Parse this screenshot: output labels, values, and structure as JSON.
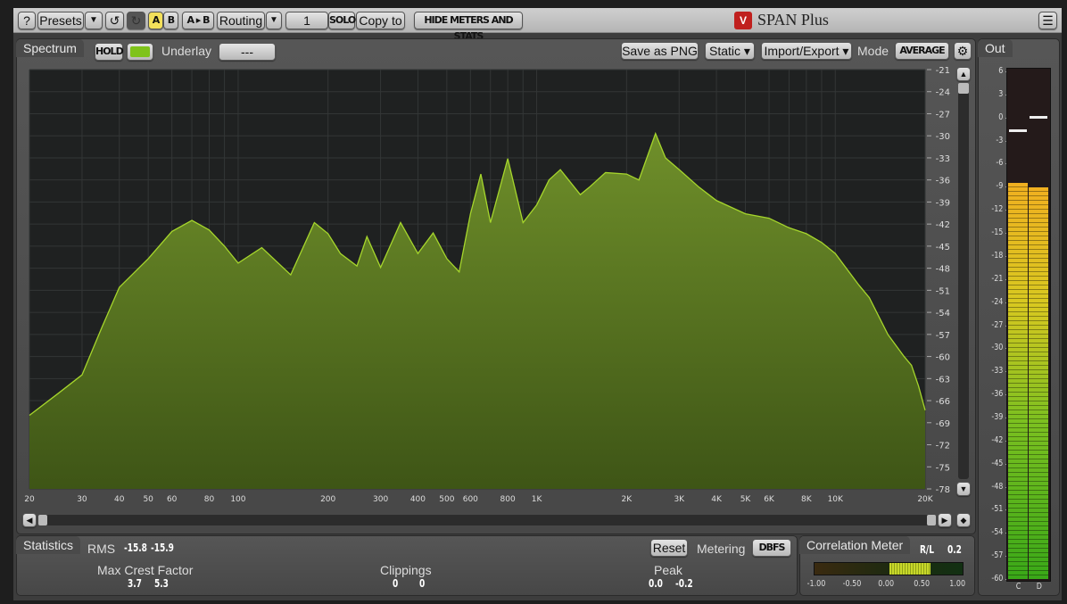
{
  "toolbar": {
    "help": "?",
    "presets": "Presets",
    "ab_a": "A",
    "ab_b": "B",
    "a_to_b": "A ▸ B",
    "routing": "Routing",
    "channel": "1",
    "solo": "SOLO",
    "copy_to": "Copy to",
    "hide_meters": "HIDE METERS AND STATS"
  },
  "app": {
    "title": "SPAN Plus"
  },
  "spectrum": {
    "tab": "Spectrum",
    "hold": "HOLD",
    "underlay_label": "Underlay",
    "underlay_value": "---",
    "save_png": "Save as PNG",
    "static": "Static ▾",
    "import_export": "Import/Export ▾",
    "mode_label": "Mode",
    "mode_value": "AVERAGE",
    "hold_color": "#7fc31a"
  },
  "chart_data": {
    "type": "area",
    "xscale": "log",
    "xlim": [
      20,
      20000
    ],
    "ylim": [
      -78,
      -21
    ],
    "x_ticks": [
      {
        "v": 20,
        "l": "20"
      },
      {
        "v": 30,
        "l": "30"
      },
      {
        "v": 40,
        "l": "40"
      },
      {
        "v": 50,
        "l": "50"
      },
      {
        "v": 60,
        "l": "60"
      },
      {
        "v": 80,
        "l": "80"
      },
      {
        "v": 100,
        "l": "100"
      },
      {
        "v": 200,
        "l": "200"
      },
      {
        "v": 300,
        "l": "300"
      },
      {
        "v": 400,
        "l": "400"
      },
      {
        "v": 500,
        "l": "500"
      },
      {
        "v": 600,
        "l": "600"
      },
      {
        "v": 800,
        "l": "800"
      },
      {
        "v": 1000,
        "l": "1K"
      },
      {
        "v": 2000,
        "l": "2K"
      },
      {
        "v": 3000,
        "l": "3K"
      },
      {
        "v": 4000,
        "l": "4K"
      },
      {
        "v": 5000,
        "l": "5K"
      },
      {
        "v": 6000,
        "l": "6K"
      },
      {
        "v": 8000,
        "l": "8K"
      },
      {
        "v": 10000,
        "l": "10K"
      },
      {
        "v": 20000,
        "l": "20K"
      }
    ],
    "y_ticks": [
      -21,
      -24,
      -27,
      -30,
      -33,
      -36,
      -39,
      -42,
      -45,
      -48,
      -51,
      -54,
      -57,
      -60,
      -63,
      -66,
      -69,
      -72,
      -75,
      -78
    ],
    "x": [
      20,
      25,
      30,
      35,
      40,
      50,
      60,
      70,
      80,
      90,
      100,
      120,
      150,
      180,
      200,
      220,
      250,
      270,
      300,
      350,
      400,
      450,
      500,
      550,
      600,
      650,
      700,
      800,
      900,
      1000,
      1100,
      1200,
      1400,
      1500,
      1700,
      2000,
      2200,
      2500,
      2700,
      3000,
      3500,
      4000,
      5000,
      6000,
      7000,
      8000,
      9000,
      10000,
      12000,
      13000,
      15000,
      17000,
      18000,
      19000,
      20000
    ],
    "y": [
      -68,
      -65,
      -62.5,
      -56,
      -50.6,
      -46.7,
      -43,
      -41.5,
      -42.8,
      -45,
      -47.3,
      -45.2,
      -48.9,
      -41.8,
      -43.3,
      -46,
      -47.7,
      -43.7,
      -47.9,
      -41.8,
      -46,
      -43.2,
      -46.7,
      -48.5,
      -40.6,
      -35.2,
      -41.8,
      -33.1,
      -41.8,
      -39.4,
      -36,
      -34.6,
      -38,
      -37,
      -35,
      -35.2,
      -36,
      -29.7,
      -33,
      -34.6,
      -37,
      -38.8,
      -40.6,
      -41.2,
      -42.5,
      -43.3,
      -44.5,
      -46,
      -50.3,
      -52,
      -57,
      -60,
      -61.2,
      -64,
      -67.3
    ]
  },
  "statistics": {
    "tab": "Statistics",
    "rms_label": "RMS",
    "rms_l": "-15.8",
    "rms_r": "-15.9",
    "reset": "Reset",
    "metering_label": "Metering",
    "metering_value": "DBFS",
    "crest_label": "Max Crest Factor",
    "crest_l": "3.7",
    "crest_r": "5.3",
    "clip_label": "Clippings",
    "clip_l": "0",
    "clip_r": "0",
    "peak_label": "Peak",
    "peak_l": "0.0",
    "peak_r": "-0.2"
  },
  "correlation": {
    "tab": "Correlation Meter",
    "rl_label": "R/L",
    "value": "0.2",
    "ticks": [
      "-1.00",
      "-0.50",
      "0.00",
      "0.50",
      "1.00"
    ]
  },
  "out_meter": {
    "tab": "Out",
    "scale": [
      "6",
      "3",
      "0",
      "-3",
      "-6",
      "-9",
      "-12",
      "-15",
      "-18",
      "-21",
      "-24",
      "-27",
      "-30",
      "-33",
      "-36",
      "-39",
      "-42",
      "-45",
      "-48",
      "-51",
      "-54",
      "-57",
      "-60"
    ],
    "left_level_db": -8.5,
    "right_level_db": -9.1,
    "left_peak_db": -1.5,
    "right_peak_db": 0.2,
    "channels": [
      "C",
      "D"
    ]
  }
}
